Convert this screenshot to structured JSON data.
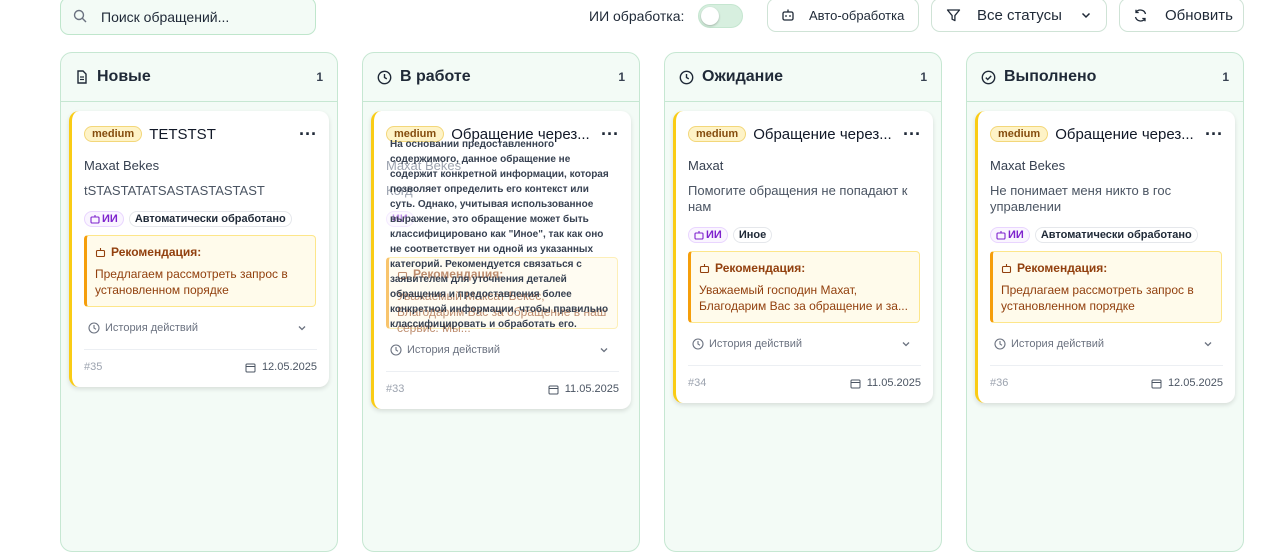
{
  "toolbar": {
    "search_placeholder": "Поиск обращений...",
    "ai_label": "ИИ обработка:",
    "auto_button": "Авто-обработка",
    "status_filter": "Все статусы",
    "refresh_button": "Обновить"
  },
  "columns": [
    {
      "title": "Новые",
      "count": "1",
      "card": {
        "priority": "medium",
        "title": "TETSTST",
        "author": "Maxat Bekes",
        "description": "tSTASTATATSASTASTASTAST",
        "ai_tag": "ИИ",
        "tag": "Автоматически обработано",
        "rec_title": "Рекомендация:",
        "rec_text": "Предлагаем рассмотреть запрос в установленном порядке",
        "history": "История действий",
        "id": "#35",
        "date": "12.05.2025"
      }
    },
    {
      "title": "В работе",
      "count": "1",
      "card": {
        "priority": "medium",
        "title": "Обращение через...",
        "author": "Maxat Bekes",
        "description": "Когд",
        "ai_tag": "ИИ",
        "tag": "",
        "rec_title": "Рекомендация:",
        "rec_text": "Уважаемый Максат Бекес, Благодарим Вас за обращение в наш сервис. Мы...",
        "history": "История действий",
        "id": "#33",
        "date": "11.05.2025",
        "tooltip": "На основании предоставленного содержимого, данное обращение не содержит конкретной информации, которая позволяет определить его контекст или суть. Однако, учитывая использованное выражение, это обращение может быть классифицировано как \"Иное\", так как оно не соответствует ни одной из указанных категорий. Рекомендуется связаться с заявителем для уточнения деталей обращения и предоставления более конкретной информации, чтобы правильно классифицировать и обработать его."
      }
    },
    {
      "title": "Ожидание",
      "count": "1",
      "card": {
        "priority": "medium",
        "title": "Обращение через...",
        "author": "Maxat",
        "description": "Помогите обращения не попадают к нам",
        "ai_tag": "ИИ",
        "tag": "Иное",
        "rec_title": "Рекомендация:",
        "rec_text": "Уважаемый господин Махат, Благодарим Вас за обращение и за...",
        "history": "История действий",
        "id": "#34",
        "date": "11.05.2025"
      }
    },
    {
      "title": "Выполнено",
      "count": "1",
      "card": {
        "priority": "medium",
        "title": "Обращение через...",
        "author": "Maxat Bekes",
        "description": "Не понимает меня никто в гос управлении",
        "ai_tag": "ИИ",
        "tag": "Автоматически обработано",
        "rec_title": "Рекомендация:",
        "rec_text": "Предлагаем рассмотреть запрос в установленном порядке",
        "history": "История действий",
        "id": "#36",
        "date": "12.05.2025"
      }
    }
  ]
}
